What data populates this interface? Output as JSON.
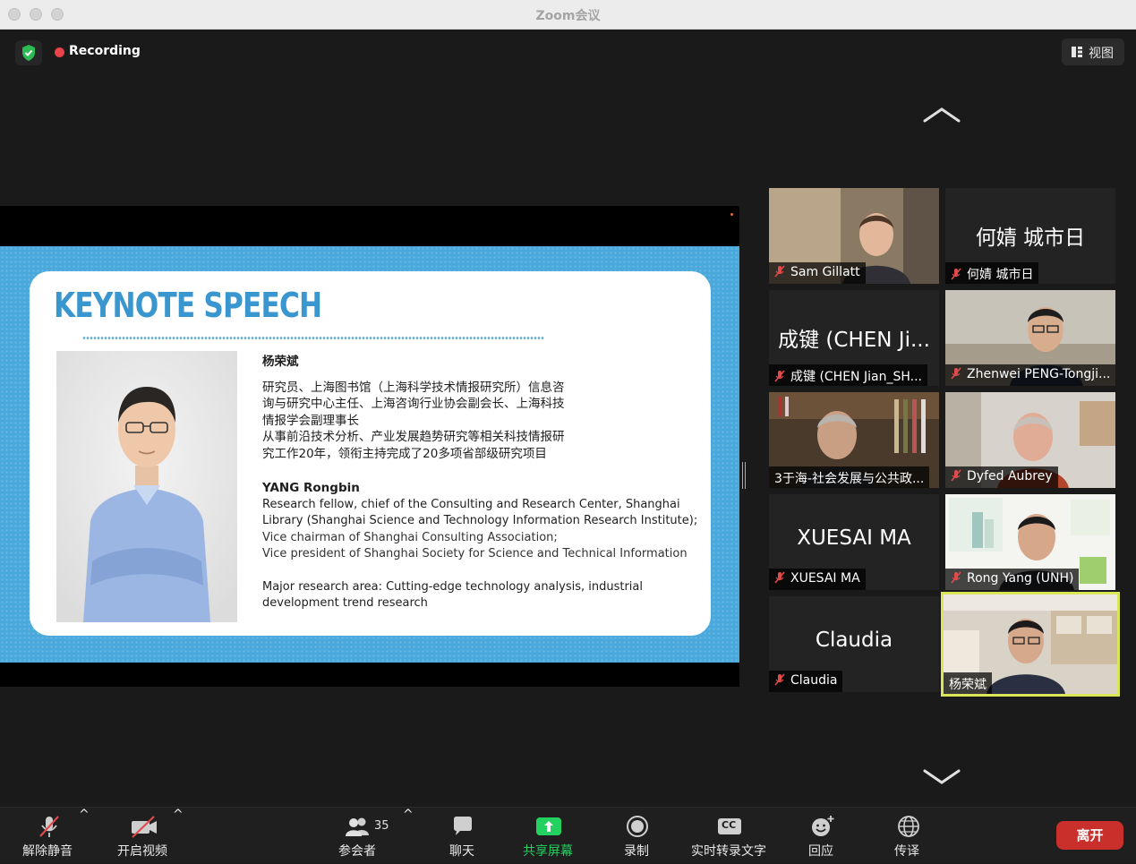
{
  "window": {
    "title": "Zoom会议"
  },
  "status": {
    "recording_label": "Recording",
    "view_label": "视图"
  },
  "slide": {
    "heading": "KEYNOTE SPEECH",
    "name_cn": "杨荣斌",
    "cn_lines": [
      "研究员、上海图书馆（上海科学技术情报研究所）信息咨",
      "询与研究中心主任、上海咨询行业协会副会长、上海科技",
      "情报学会副理事长",
      "从事前沿技术分析、产业发展趋势研究等相关科技情报研",
      "究工作20年，领衔主持完成了20多项省部级研究项目"
    ],
    "name_en": "YANG Rongbin",
    "en_lines": [
      "Research fellow, chief of the Consulting and Research Center, Shanghai",
      "Library (Shanghai Science and Technology Information Research Institute);",
      "Vice chairman of Shanghai Consulting Association;",
      "Vice president of Shanghai Society for Science and Technical Information"
    ],
    "research_lines": [
      "Major research area: Cutting-edge technology analysis, industrial",
      "development trend research"
    ]
  },
  "gallery": [
    {
      "name": "Sam Gillatt",
      "big": "",
      "video": true,
      "muted": true
    },
    {
      "name": "何婧 城市日",
      "big": "何婧 城市日",
      "video": false,
      "muted": true
    },
    {
      "name": "成键 (CHEN Jian_SH...",
      "big": "成键 (CHEN Ji...",
      "video": false,
      "muted": true
    },
    {
      "name": "Zhenwei PENG-Tongji...",
      "big": "",
      "video": true,
      "muted": true
    },
    {
      "name": "3于海-社会发展与公共政...",
      "big": "",
      "video": true,
      "muted": false
    },
    {
      "name": "Dyfed Aubrey",
      "big": "",
      "video": true,
      "muted": true
    },
    {
      "name": "XUESAI MA",
      "big": "XUESAI MA",
      "video": false,
      "muted": true
    },
    {
      "name": "Rong Yang (UNH)",
      "big": "",
      "video": true,
      "muted": true
    },
    {
      "name": "Claudia",
      "big": "Claudia",
      "video": false,
      "muted": true
    },
    {
      "name": "杨荣斌",
      "big": "",
      "video": true,
      "muted": false,
      "active": true
    }
  ],
  "toolbar": {
    "unmute_label": "解除静音",
    "video_label": "开启视频",
    "participants_label": "参会者",
    "participants_count": "35",
    "chat_label": "聊天",
    "share_label": "共享屏幕",
    "record_label": "录制",
    "caption_label": "实时转录文字",
    "cc_text": "CC",
    "reactions_label": "回应",
    "translate_label": "传译",
    "leave_label": "离开"
  },
  "colors": {
    "share_green": "#23d160",
    "leave_red": "#c9302c",
    "active_speaker": "#d9e65a",
    "slide_blue": "#4aa9dc"
  }
}
